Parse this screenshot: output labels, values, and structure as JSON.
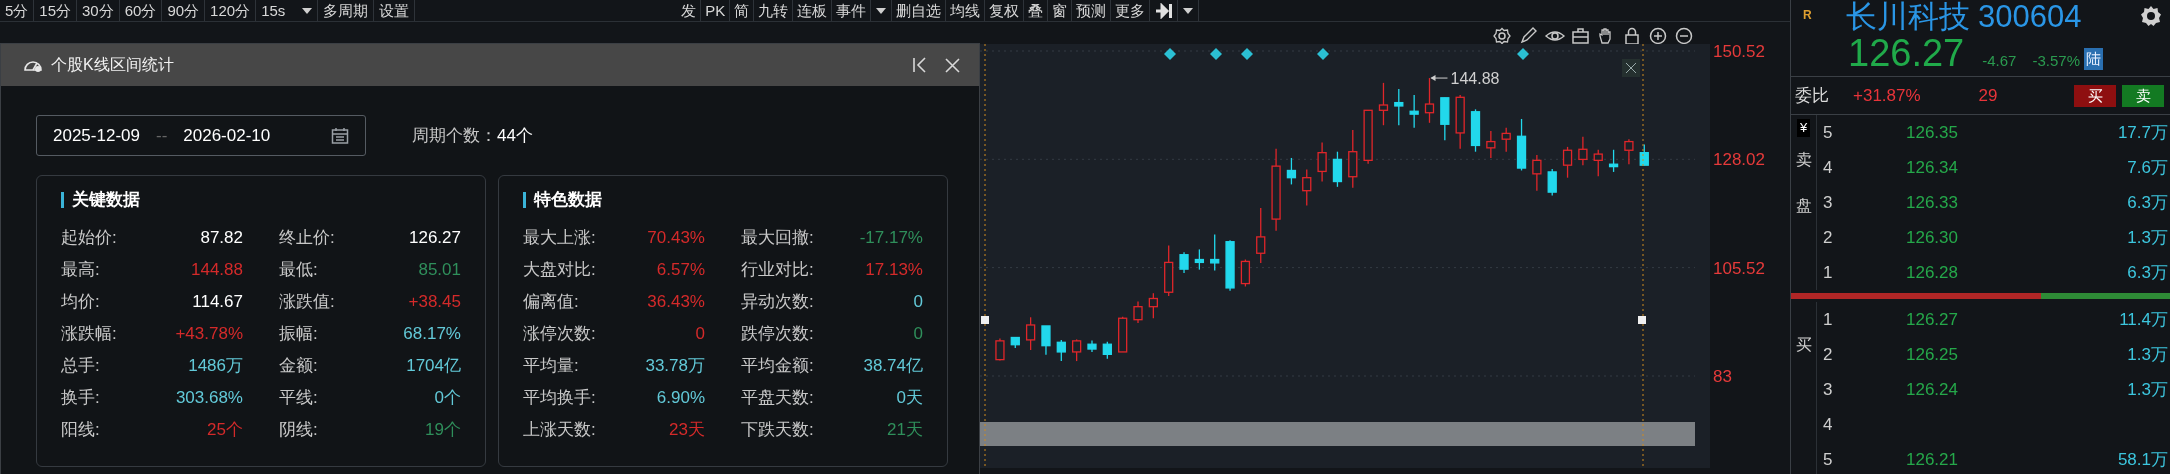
{
  "toolbar_left": [
    {
      "label": "5分",
      "kind": "button"
    },
    {
      "label": "15分",
      "kind": "button"
    },
    {
      "label": "30分",
      "kind": "button"
    },
    {
      "label": "60分",
      "kind": "button"
    },
    {
      "label": "90分",
      "kind": "button"
    },
    {
      "label": "120分",
      "kind": "button"
    },
    {
      "label": "15s",
      "kind": "dropdown"
    },
    {
      "label": "多周期",
      "kind": "button"
    },
    {
      "label": "设置",
      "kind": "button"
    }
  ],
  "toolbar_right": [
    {
      "label": "发",
      "kind": "button"
    },
    {
      "label": "PK",
      "kind": "button"
    },
    {
      "label": "简",
      "kind": "button"
    },
    {
      "label": "九转",
      "kind": "button"
    },
    {
      "label": "连板",
      "kind": "button"
    },
    {
      "label": "事件",
      "kind": "button"
    },
    {
      "kind": "caret"
    },
    {
      "label": "删自选",
      "kind": "button"
    },
    {
      "label": "均线",
      "kind": "button"
    },
    {
      "label": "复权",
      "kind": "button"
    },
    {
      "label": "叠",
      "kind": "button"
    },
    {
      "label": "窗",
      "kind": "button"
    },
    {
      "label": "预测",
      "kind": "button"
    },
    {
      "label": "更多",
      "kind": "button"
    },
    {
      "kind": "exit"
    },
    {
      "kind": "caret"
    }
  ],
  "dialog": {
    "title": "个股K线区间统计",
    "date_from": "2025-12-09",
    "date_separator": "--",
    "date_to": "2026-02-10",
    "period_count_label": "周期个数：",
    "period_count": "44个",
    "panels": [
      {
        "title": "关键数据",
        "items": [
          {
            "label": "起始价:",
            "value": "87.82",
            "color": "#ffffff"
          },
          {
            "label": "终止价:",
            "value": "126.27",
            "color": "#ffffff"
          },
          {
            "label": "最高:",
            "value": "144.88",
            "color": "#d42a2a"
          },
          {
            "label": "最低:",
            "value": "85.01",
            "color": "#2f8f5b"
          },
          {
            "label": "均价:",
            "value": "114.67",
            "color": "#ffffff"
          },
          {
            "label": "涨跌值:",
            "value": "+38.45",
            "color": "#d42a2a"
          },
          {
            "label": "涨跌幅:",
            "value": "+43.78%",
            "color": "#d42a2a"
          },
          {
            "label": "振幅:",
            "value": "68.17%",
            "color": "#62c9d8"
          },
          {
            "label": "总手:",
            "value": "1486万",
            "color": "#62c9d8"
          },
          {
            "label": "金额:",
            "value": "1704亿",
            "color": "#62c9d8"
          },
          {
            "label": "换手:",
            "value": "303.68%",
            "color": "#62c9d8"
          },
          {
            "label": "平线:",
            "value": "0个",
            "color": "#62c9d8"
          },
          {
            "label": "阳线:",
            "value": "25个",
            "color": "#d42a2a"
          },
          {
            "label": "阴线:",
            "value": "19个",
            "color": "#2f8f5b"
          }
        ]
      },
      {
        "title": "特色数据",
        "items": [
          {
            "label": "最大上涨:",
            "value": "70.43%",
            "color": "#d42a2a"
          },
          {
            "label": "最大回撤:",
            "value": "-17.17%",
            "color": "#2f8f5b"
          },
          {
            "label": "大盘对比:",
            "value": "6.57%",
            "color": "#d42a2a"
          },
          {
            "label": "行业对比:",
            "value": "17.13%",
            "color": "#d42a2a"
          },
          {
            "label": "偏离值:",
            "value": "36.43%",
            "color": "#d42a2a"
          },
          {
            "label": "异动次数:",
            "value": "0",
            "color": "#62c9d8"
          },
          {
            "label": "涨停次数:",
            "value": "0",
            "color": "#d42a2a"
          },
          {
            "label": "跌停次数:",
            "value": "0",
            "color": "#2f8f5b"
          },
          {
            "label": "平均量:",
            "value": "33.78万",
            "color": "#62c9d8"
          },
          {
            "label": "平均金额:",
            "value": "38.74亿",
            "color": "#62c9d8"
          },
          {
            "label": "平均换手:",
            "value": "6.90%",
            "color": "#62c9d8"
          },
          {
            "label": "平盘天数:",
            "value": "0天",
            "color": "#62c9d8"
          },
          {
            "label": "上涨天数:",
            "value": "23天",
            "color": "#d42a2a"
          },
          {
            "label": "下跌天数:",
            "value": "21天",
            "color": "#2f8f5b"
          }
        ]
      }
    ]
  },
  "chart": {
    "chart_data": {
      "type": "candlestick",
      "ylim": [
        83,
        150.52
      ],
      "grid": true,
      "yticks": [
        {
          "value": 150.52,
          "label": "150.52"
        },
        {
          "value": 128.02,
          "label": "128.02"
        },
        {
          "value": 105.52,
          "label": "105.52"
        },
        {
          "value": 83,
          "label": "83"
        }
      ],
      "ohlc": [
        [
          86.4,
          90.8,
          86.2,
          90.3
        ],
        [
          91.0,
          91.0,
          88.8,
          89.5
        ],
        [
          90.5,
          95.2,
          88.4,
          93.6
        ],
        [
          93.4,
          93.4,
          87.4,
          89.3
        ],
        [
          90.0,
          90.5,
          86.1,
          88.0
        ],
        [
          88.0,
          90.6,
          86.1,
          90.3
        ],
        [
          89.6,
          90.4,
          88.0,
          88.6
        ],
        [
          89.6,
          90.1,
          86.6,
          87.5
        ],
        [
          88.0,
          95.3,
          88.0,
          95.0
        ],
        [
          94.7,
          98.5,
          94.0,
          97.4
        ],
        [
          97.4,
          100.2,
          95.0,
          99.1
        ],
        [
          100.4,
          110.1,
          99.6,
          106.6
        ],
        [
          108.2,
          108.7,
          104.4,
          105.2
        ],
        [
          107.2,
          109.3,
          105.1,
          106.6
        ],
        [
          107.2,
          112.4,
          104.9,
          106.5
        ],
        [
          110.9,
          111.2,
          100.7,
          101.3
        ],
        [
          102.2,
          107.2,
          101.6,
          106.8
        ],
        [
          108.5,
          117.9,
          106.5,
          111.9
        ],
        [
          115.6,
          130.2,
          113.2,
          126.6
        ],
        [
          125.7,
          128.3,
          122.8,
          124.2
        ],
        [
          121.5,
          125.9,
          118.4,
          124.2
        ],
        [
          125.5,
          131.5,
          123.4,
          129.4
        ],
        [
          128.0,
          129.6,
          122.3,
          123.4
        ],
        [
          124.4,
          134.1,
          122.1,
          129.6
        ],
        [
          127.8,
          138.2,
          127.1,
          138.2
        ],
        [
          138.2,
          143.9,
          135.1,
          139.3
        ],
        [
          139.8,
          142.6,
          135.1,
          139.1
        ],
        [
          138.0,
          141.4,
          134.6,
          137.4
        ],
        [
          137.7,
          144.9,
          135.6,
          139.5
        ],
        [
          140.8,
          140.8,
          132.0,
          135.3
        ],
        [
          133.5,
          141.4,
          130.2,
          140.9
        ],
        [
          137.9,
          138.4,
          129.6,
          130.9
        ],
        [
          130.4,
          133.9,
          128.3,
          131.7
        ],
        [
          132.2,
          134.6,
          129.6,
          133.4
        ],
        [
          132.8,
          136.4,
          125.7,
          126.2
        ],
        [
          125.0,
          128.9,
          121.5,
          127.8
        ],
        [
          125.4,
          126.0,
          120.5,
          121.2
        ],
        [
          126.8,
          130.6,
          124.2,
          129.9
        ],
        [
          128.0,
          132.7,
          126.8,
          130.1
        ],
        [
          127.8,
          130.0,
          124.5,
          129.1
        ],
        [
          127.0,
          130.0,
          125.4,
          126.5
        ],
        [
          129.9,
          132.2,
          127.0,
          131.7
        ],
        [
          129.4,
          131.1,
          126.8,
          126.8
        ]
      ],
      "annotations": [
        "144.88"
      ]
    }
  },
  "quote": {
    "badge": "R",
    "name": "长川科技",
    "code": "300604",
    "price": "126.27",
    "change": "-4.67",
    "change_pct": "-3.57%",
    "market_tag": "陆"
  },
  "order_ratio": {
    "label": "委比",
    "value": "+31.87%",
    "difference": "29",
    "buy_button": "买",
    "sell_button": "卖"
  },
  "order_book": {
    "currency": "¥",
    "ask_label": "卖盘",
    "bid_label": "买",
    "asks": [
      {
        "level": "5",
        "price": "126.35",
        "volume": "17.7万"
      },
      {
        "level": "4",
        "price": "126.34",
        "volume": "7.6万"
      },
      {
        "level": "3",
        "price": "126.33",
        "volume": "6.3万"
      },
      {
        "level": "2",
        "price": "126.30",
        "volume": "1.3万"
      },
      {
        "level": "1",
        "price": "126.28",
        "volume": "6.3万"
      }
    ],
    "depth": {
      "level": 0.66
    },
    "bids": [
      {
        "level": "1",
        "price": "126.27",
        "volume": "11.4万"
      },
      {
        "level": "2",
        "price": "126.25",
        "volume": "1.3万"
      },
      {
        "level": "3",
        "price": "126.24",
        "volume": "1.3万"
      },
      {
        "level": "4"
      },
      {
        "level": "5",
        "price": "126.21",
        "volume": "58.1万"
      }
    ]
  }
}
